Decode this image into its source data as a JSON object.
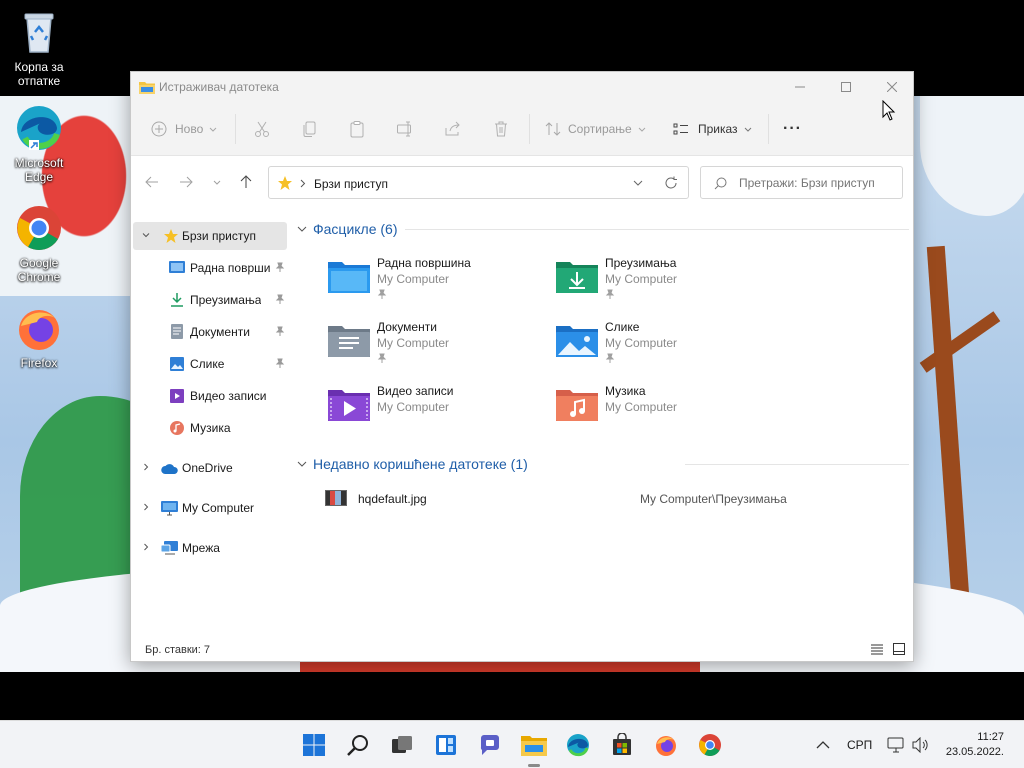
{
  "desktop": {
    "icons": [
      {
        "label": "Корпа за отпатке",
        "icon": "recycle-bin-icon"
      },
      {
        "label": "Microsoft Edge",
        "icon": "edge-icon"
      },
      {
        "label": "Google Chrome",
        "icon": "chrome-icon"
      },
      {
        "label": "Firefox",
        "icon": "firefox-icon"
      }
    ]
  },
  "window": {
    "title": "Истраживач датотека",
    "toolbar": {
      "new_label": "Ново",
      "sort_label": "Сортирање",
      "view_label": "Приказ",
      "more_label": "···"
    },
    "address": {
      "path": "Брзи приступ"
    },
    "search": {
      "placeholder": "Претражи: Брзи приступ"
    },
    "nav": {
      "quick_access": "Брзи приступ",
      "items": [
        {
          "label": "Радна површи",
          "icon": "desktop-icon",
          "pinned": true
        },
        {
          "label": "Преузимања",
          "icon": "downloads-icon",
          "pinned": true
        },
        {
          "label": "Документи",
          "icon": "documents-icon",
          "pinned": true
        },
        {
          "label": "Слике",
          "icon": "pictures-icon",
          "pinned": true
        },
        {
          "label": "Видео записи",
          "icon": "videos-icon",
          "pinned": false
        },
        {
          "label": "Музика",
          "icon": "music-icon",
          "pinned": false
        }
      ],
      "onedrive": "OneDrive",
      "this_pc": "My Computer",
      "network": "Мрежа"
    },
    "folders_header": "Фасцикле (6)",
    "folders": [
      {
        "name": "Радна површина",
        "location": "My Computer",
        "pinned": true
      },
      {
        "name": "Преузимања",
        "location": "My Computer",
        "pinned": true
      },
      {
        "name": "Документи",
        "location": "My Computer",
        "pinned": true
      },
      {
        "name": "Слике",
        "location": "My Computer",
        "pinned": true
      },
      {
        "name": "Видео записи",
        "location": "My Computer",
        "pinned": false
      },
      {
        "name": "Музика",
        "location": "My Computer",
        "pinned": false
      }
    ],
    "recent_header": "Недавно коришћене датотеке (1)",
    "recent": [
      {
        "name": "hqdefault.jpg",
        "path": "My Computer\\Преузимања"
      }
    ],
    "status": {
      "count": "Бр. ставки: 7"
    }
  },
  "taskbar": {
    "language": "СРП",
    "time": "11:27",
    "date": "23.05.2022."
  },
  "colors": {
    "accent": "#1f5ea8",
    "folder_yellow": "#f4c542",
    "taskbar_bg": "#f2f3f6"
  }
}
